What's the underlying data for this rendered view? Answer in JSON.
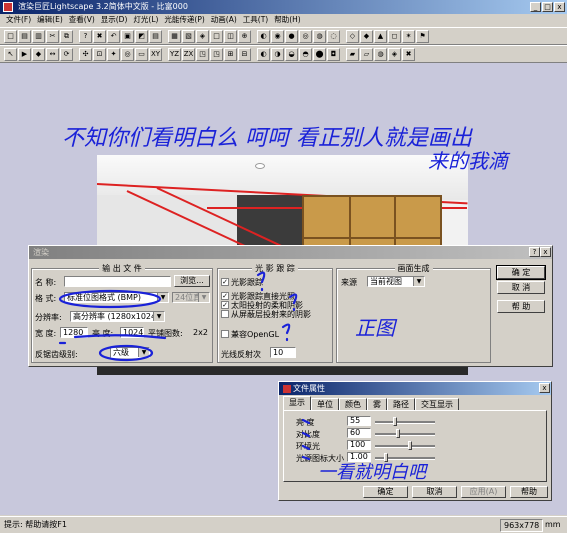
{
  "app": {
    "title": "渲染巨匠Lightscape 3.2简体中文版 - 比富000"
  },
  "menu": [
    "文件(F)",
    "编辑(E)",
    "查看(V)",
    "显示(D)",
    "灯光(L)",
    "光能传递(P)",
    "动画(A)",
    "工具(T)",
    "帮助(H)"
  ],
  "toolbar1": [
    "□",
    "▤",
    "▥",
    "✂",
    "⧉",
    "?",
    "✖",
    "↶",
    "▣",
    "◩",
    "▤",
    "▦",
    "▧",
    "◈",
    "□",
    "◫",
    "⊕",
    "◐",
    "◉",
    "●",
    "◎",
    "◍",
    "◌",
    "◇",
    "◆",
    "▲",
    "◻",
    "✶",
    "⚑"
  ],
  "toolbar2": [
    "↖",
    "▶",
    "◆",
    "↔",
    "⟳",
    "✣",
    "⊡",
    "✦",
    "◎",
    "▭",
    "XY",
    "YZ",
    "ZX",
    "◳",
    "◳",
    "⊞",
    "⊟",
    "◐",
    "◑",
    "◒",
    "◓",
    "⬤",
    "◘",
    "▰",
    "▱",
    "◍",
    "◈",
    "✖"
  ],
  "render_dialog": {
    "title": "渲染",
    "output_group": "输 出 文 件",
    "name_label": "名 称:",
    "name_value": "",
    "browse": "浏览...",
    "format_label": "格 式:",
    "format_value": "标准位图格式 (BMP)",
    "depth_value": "24位真",
    "resolution_label": "分辨率:",
    "resolution_value": "高分辨率 (1280x1024)",
    "width_label": "宽 度:",
    "width_value": "1280",
    "height_label": "高 度:",
    "height_value": "1024",
    "tile_label": "平铺图数:",
    "tile_value": "2x2",
    "aa_label": "反锯齿级别:",
    "aa_value": "六级",
    "ray_group": "光 影 跟 踪",
    "ray_trace": "光影跟踪",
    "ray_direct": "光影跟踪直接光照",
    "sun_soft": "太阳投射的柔和阴影",
    "sky_soft": "从屏蔽层投射来的阴影",
    "opengl": "兼容OpenGL",
    "reflect_label": "光线反射次",
    "reflect_value": "10",
    "frame_group": "画面生成",
    "source_label": "来源",
    "source_value": "当前视图",
    "ok": "确 定",
    "cancel": "取 消",
    "help": "帮 助",
    "help_q": "?"
  },
  "file_props": {
    "title": "文件属性",
    "tabs": [
      "显示",
      "单位",
      "颜色",
      "雾",
      "路径",
      "交互显示"
    ],
    "rows": [
      {
        "label": "亮 度",
        "value": "55",
        "pct": 0.3
      },
      {
        "label": "对比度",
        "value": "60",
        "pct": 0.35
      },
      {
        "label": "环境光",
        "value": "100",
        "pct": 0.55
      },
      {
        "label": "光源图标大小",
        "value": "1.00",
        "pct": 0.15
      }
    ],
    "ok": "确定",
    "cancel": "取消",
    "apply": "应用(A)",
    "help": "帮助"
  },
  "annotations": {
    "top": "不知你们看明白么 呵呵 看正别人就是画出",
    "top2": "来的我滴",
    "mid": "正图",
    "bottom": "一看就明白吧"
  },
  "status": {
    "hint": "提示: 帮助请按F1",
    "size": "963x778",
    "unit": "mm"
  }
}
